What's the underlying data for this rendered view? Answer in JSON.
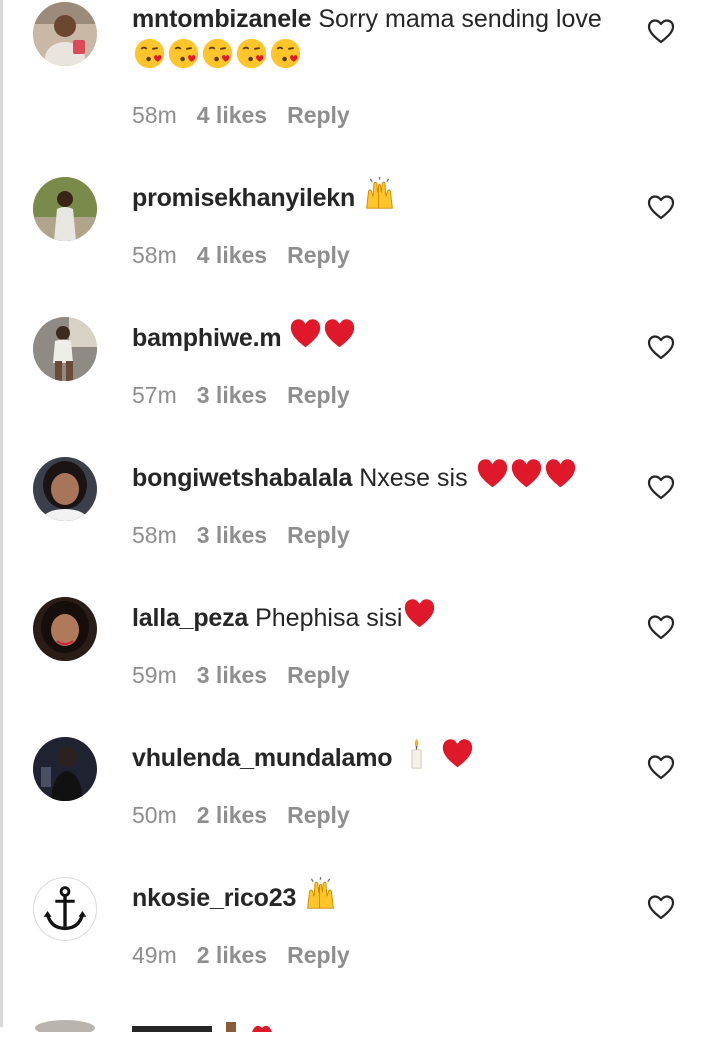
{
  "comments": [
    {
      "username": "mntombizanele",
      "text": "Sorry mama sending love",
      "emojis": [
        "kissing-heart",
        "kissing-heart",
        "kissing-heart",
        "kissing-heart",
        "kissing-heart"
      ],
      "time": "58m",
      "likes": "4 likes",
      "reply": "Reply",
      "avatar": "avatar-mntombizanele"
    },
    {
      "username": "promisekhanyilekn",
      "text": "",
      "emojis": [
        "raised-hands"
      ],
      "time": "58m",
      "likes": "4 likes",
      "reply": "Reply",
      "avatar": "avatar-promisekhanyilekn"
    },
    {
      "username": "bamphiwe.m",
      "text": "",
      "emojis": [
        "red-heart",
        "red-heart"
      ],
      "time": "57m",
      "likes": "3 likes",
      "reply": "Reply",
      "avatar": "avatar-bamphiwe"
    },
    {
      "username": "bongiwetshabalala",
      "text": "Nxese sis",
      "emojis": [
        "red-heart",
        "red-heart",
        "red-heart"
      ],
      "time": "58m",
      "likes": "3 likes",
      "reply": "Reply",
      "avatar": "avatar-bongiwetshabalala"
    },
    {
      "username": "lalla_peza",
      "text": "Phephisa sisi",
      "emojis": [
        "red-heart"
      ],
      "time": "59m",
      "likes": "3 likes",
      "reply": "Reply",
      "avatar": "avatar-lalla-peza"
    },
    {
      "username": "vhulenda_mundalamo",
      "text": "",
      "emojis": [
        "candle",
        "red-heart"
      ],
      "time": "50m",
      "likes": "2 likes",
      "reply": "Reply",
      "avatar": "avatar-vhulenda"
    },
    {
      "username": "nkosie_rico23",
      "text": "",
      "emojis": [
        "raised-hands"
      ],
      "time": "49m",
      "likes": "2 likes",
      "reply": "Reply",
      "avatar": "anchor-icon"
    }
  ],
  "colors": {
    "text": "#262626",
    "meta": "#8e8e8e",
    "heart": "#e0192a",
    "emoji_yellow": "#ffc52b",
    "background": "#ffffff"
  }
}
